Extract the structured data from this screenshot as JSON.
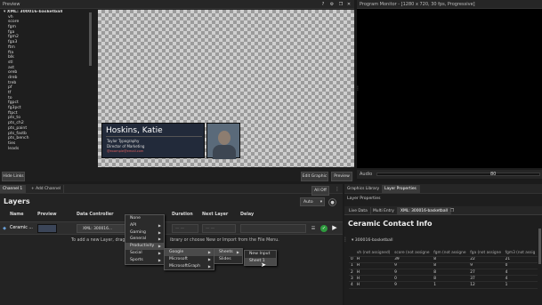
{
  "preview": {
    "title": "Preview",
    "hide_links": "Hide Links",
    "edit_graphic": "Edit Graphic",
    "preview_btn": "Preview",
    "tree_root": "XML: 300016-basketball",
    "tree_items": [
      "vh",
      "score",
      "fgm",
      "fga",
      "fgm2",
      "fga3",
      "ftm",
      "fta",
      "blk",
      "stl",
      "ast",
      "oreb",
      "dreb",
      "treb",
      "pf",
      "tf",
      "to",
      "fgpct",
      "fg3pct",
      "ftpct",
      "pts_to",
      "pts_ch2",
      "pts_paint",
      "pts_fastb",
      "pts_bench",
      "ties",
      "leads"
    ],
    "card": {
      "name": "Hoskins, Katie",
      "line1": "Taylor Typography",
      "line2": "Director of Marketing",
      "line3": "@example@email.com"
    }
  },
  "program": {
    "title": "Program Monitor - [1280 x 720, 30 fps, Progressive]"
  },
  "audio": {
    "label": "Audio",
    "value": "80"
  },
  "layers": {
    "tab_channel": "Channel 1",
    "add_channel": "+ Add Channel",
    "all_off": "All Off",
    "title": "Layers",
    "auto": "Auto",
    "columns": [
      "Name",
      "Preview",
      "Data Controller",
      "Duration",
      "Next Layer",
      "Delay"
    ],
    "row": {
      "name": "Ceramic ...",
      "controller": "XML: 300016..."
    },
    "hint_left": "To add a new Layer, drag",
    "hint_right": "ibrary or choose New or Import from the File Menu."
  },
  "menus": {
    "main": [
      {
        "label": "None",
        "sub": false
      },
      {
        "label": "API",
        "sub": true
      },
      {
        "label": "Gaming",
        "sub": true
      },
      {
        "label": "General",
        "sub": true
      },
      {
        "label": "Productivity",
        "sub": true
      },
      {
        "label": "Social",
        "sub": true
      },
      {
        "label": "Sports",
        "sub": true
      }
    ],
    "productivity": [
      {
        "label": "Google",
        "sub": true
      },
      {
        "label": "Microsoft",
        "sub": true
      },
      {
        "label": "MicrosoftGraph",
        "sub": true
      }
    ],
    "google": [
      {
        "label": "Sheets",
        "sub": true
      },
      {
        "label": "Slides",
        "sub": false
      }
    ],
    "sheets": [
      {
        "label": "New Input"
      },
      {
        "label": "Sheet 1"
      }
    ]
  },
  "right": {
    "tabs": [
      "Graphics Library",
      "Layer Properties"
    ],
    "section": "Layer Properties",
    "subtabs": [
      "Live Data",
      "Multi Entry",
      "XML: 300016-basketball"
    ],
    "heading": "Ceramic Contact Info",
    "group": "300016-basketball",
    "table_headers": [
      "vh (not assigned)",
      "score (not assigne",
      "fgm (not assigne",
      "fga (not assigne",
      "fgm3 (not assig"
    ],
    "rows": [
      [
        "0",
        "H",
        "39",
        "8",
        "22",
        "21"
      ],
      [
        "1",
        "H",
        "9",
        "8",
        "9",
        "0"
      ],
      [
        "2",
        "H",
        "9",
        "8",
        "27",
        "4"
      ],
      [
        "3",
        "H",
        "0",
        "8",
        "37",
        "4"
      ],
      [
        "4",
        "H",
        "9",
        "1",
        "12",
        "1"
      ]
    ]
  }
}
